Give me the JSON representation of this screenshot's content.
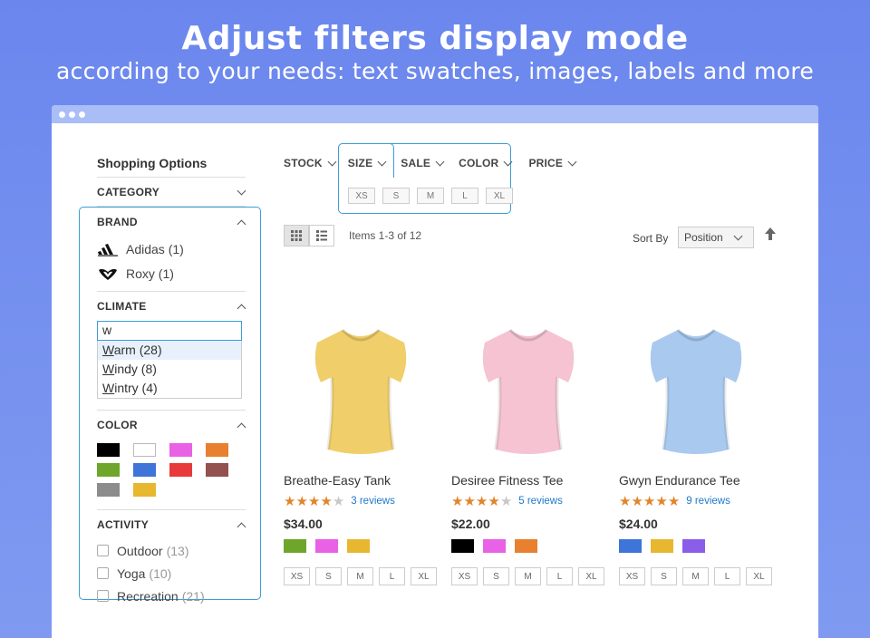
{
  "hero": {
    "title": "Adjust filters display mode",
    "subtitle": "according to your needs: text swatches, images, labels and more"
  },
  "sidebar": {
    "title": "Shopping Options",
    "category_label": "CATEGORY",
    "brand": {
      "label": "BRAND",
      "items": [
        {
          "name": "Adidas",
          "count": "(1)",
          "icon": "adidas-logo-icon"
        },
        {
          "name": "Roxy",
          "count": "(1)",
          "icon": "roxy-logo-icon"
        }
      ]
    },
    "climate": {
      "label": "CLIMATE",
      "search_value": "w",
      "options": [
        {
          "first": "W",
          "rest": "arm (28)"
        },
        {
          "first": "W",
          "rest": "indy (8)"
        },
        {
          "first": "W",
          "rest": "intry (4)"
        }
      ]
    },
    "color": {
      "label": "COLOR",
      "swatches": [
        "#000000",
        "#ffffff",
        "#e961e4",
        "#e8802f",
        "#6ea62c",
        "#3f74d8",
        "#e83a3a",
        "#93514f",
        "#8c8c8c",
        "#e8b730"
      ]
    },
    "activity": {
      "label": "ACTIVITY",
      "items": [
        {
          "name": "Outdoor",
          "count": "(13)"
        },
        {
          "name": "Yoga",
          "count": "(10)"
        },
        {
          "name": "Recreation",
          "count": "(21)"
        }
      ]
    }
  },
  "top_filters": {
    "items": [
      "STOCK",
      "SIZE",
      "SALE",
      "COLOR",
      "PRICE"
    ],
    "size_options": [
      "XS",
      "S",
      "M",
      "L",
      "XL"
    ]
  },
  "toolbar": {
    "items_count": "Items 1-3 of 12",
    "sort_label": "Sort By",
    "sort_value": "Position"
  },
  "products": [
    {
      "name": "Breathe-Easy Tank",
      "rating": 4,
      "reviews": "3 reviews",
      "price": "$34.00",
      "shirt_color": "#f0cf6a",
      "colors": [
        "#6ea62c",
        "#e961e4",
        "#e8b730"
      ],
      "sizes": [
        "XS",
        "S",
        "M",
        "L",
        "XL"
      ]
    },
    {
      "name": "Desiree Fitness Tee",
      "rating": 4,
      "reviews": "5 reviews",
      "price": "$22.00",
      "shirt_color": "#f5c3d2",
      "colors": [
        "#000000",
        "#e961e4",
        "#e8802f"
      ],
      "sizes": [
        "XS",
        "S",
        "M",
        "L",
        "XL"
      ]
    },
    {
      "name": "Gwyn Endurance Tee",
      "rating": 5,
      "reviews": "9 reviews",
      "price": "$24.00",
      "shirt_color": "#a9c9ef",
      "colors": [
        "#3f74d8",
        "#e8b730",
        "#8a5ee8"
      ],
      "sizes": [
        "XS",
        "S",
        "M",
        "L",
        "XL"
      ]
    }
  ]
}
